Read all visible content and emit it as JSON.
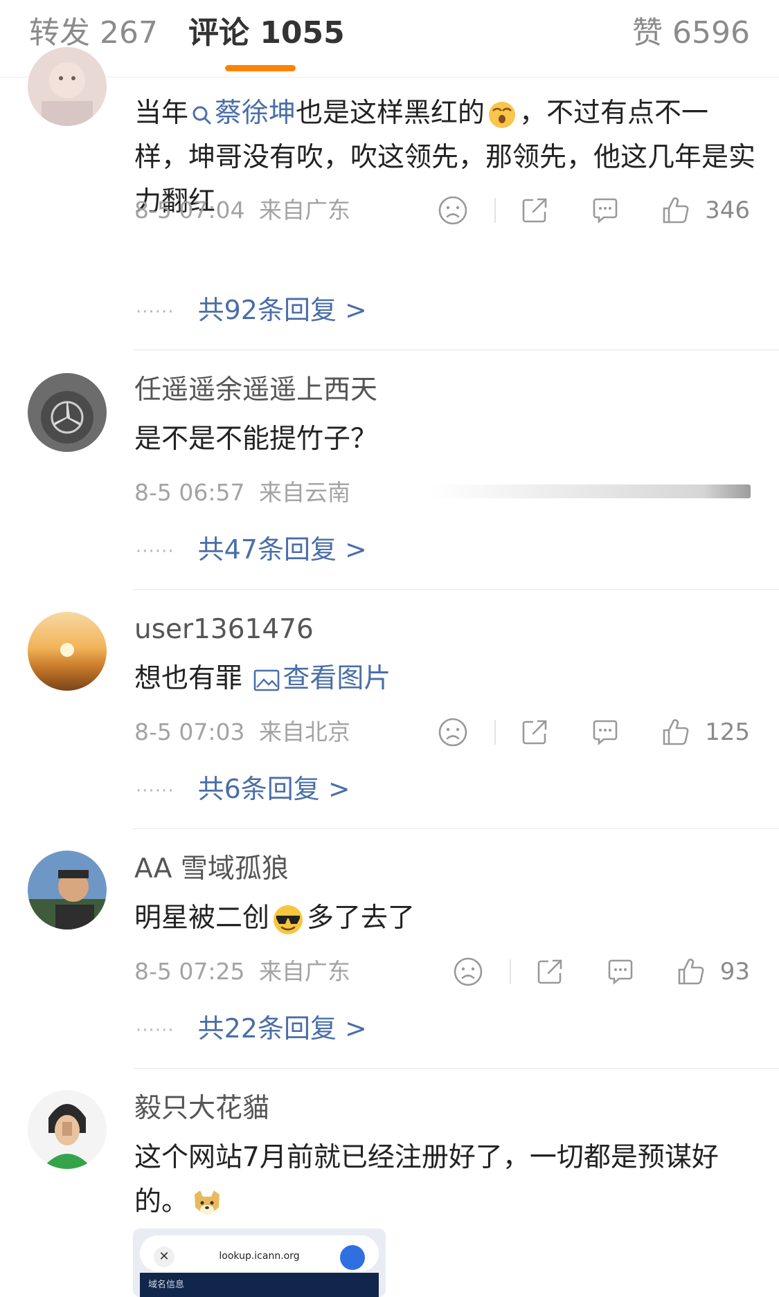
{
  "tabs": {
    "repost": "转发 267",
    "comments": "评论 1055",
    "likes": "赞 6596"
  },
  "colors": {
    "accent": "#ff8200",
    "link": "#4a6ea8"
  },
  "comments": [
    {
      "text_before": "当年",
      "topic": "蔡徐坤",
      "text_after": "也是这样黑红的",
      "text_tail": "，不过有点不一样，坤哥没有吹，吹这领先，那领先，他这几年是实力翻红",
      "emoji": "shocked-face-icon",
      "time": "8-5 07:04",
      "location": "来自广东",
      "likes": "346",
      "replies": "共92条回复 >"
    },
    {
      "username": "任遥遥余遥遥上西天",
      "text": "是不是不能提竹子？",
      "time": "8-5 06:57",
      "location": "来自云南",
      "replies": "共47条回复 >"
    },
    {
      "username": "user1361476",
      "text": "想也有罪",
      "image_link": "查看图片",
      "time": "8-5 07:03",
      "location": "来自北京",
      "likes": "125",
      "replies": "共6条回复 >"
    },
    {
      "username": "AA 雪域孤狼",
      "text_before": "明星被二创",
      "emoji": "sunglasses-face-icon",
      "text_after": "多了去了",
      "time": "8-5 07:25",
      "location": "来自广东",
      "likes": "93",
      "replies": "共22条回复 >"
    },
    {
      "username": "毅只大花貓",
      "text": "这个网站7月前就已经注册好了，一切都是预谋好的。",
      "emoji": "doge-icon",
      "thumbnail": {
        "url": "lookup.icann.org",
        "caption": "域名信息"
      }
    }
  ]
}
